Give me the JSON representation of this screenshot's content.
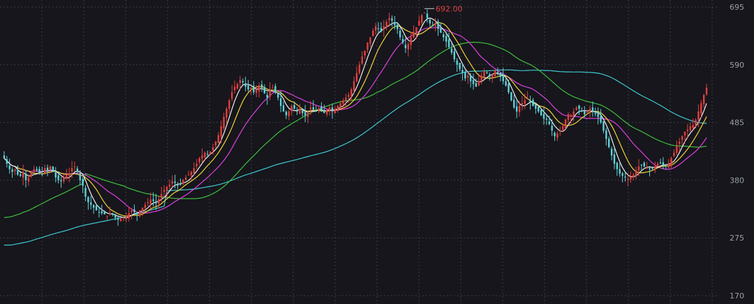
{
  "chart_data": {
    "type": "candlestick",
    "title": "",
    "xlabel": "",
    "ylabel": "",
    "ylim": [
      170,
      695
    ],
    "y_ticks": [
      {
        "value": 695,
        "label": "695"
      },
      {
        "value": 590,
        "label": "590"
      },
      {
        "value": 485,
        "label": "485"
      },
      {
        "value": 380,
        "label": "380"
      },
      {
        "value": 275,
        "label": "275"
      },
      {
        "value": 170,
        "label": "170"
      }
    ],
    "grid": true,
    "peak_annotation": {
      "value": 692.0,
      "label": "692.00"
    },
    "colors": {
      "background": "#16161c",
      "grid": "#3a3d44",
      "up": "#e0413e",
      "down": "#5fd3d9",
      "ma5": "#f0f0f0",
      "ma10": "#f2d43a",
      "ma20": "#e040e0",
      "ma60": "#3fbf3f",
      "ma120": "#3fc9d0",
      "peak": "#e0413e"
    },
    "closes": [
      420,
      410,
      400,
      395,
      400,
      390,
      388,
      395,
      380,
      385,
      392,
      400,
      398,
      395,
      390,
      402,
      398,
      405,
      395,
      385,
      380,
      378,
      385,
      390,
      392,
      402,
      405,
      395,
      380,
      370,
      350,
      340,
      335,
      330,
      325,
      322,
      320,
      318,
      315,
      320,
      318,
      312,
      308,
      310,
      312,
      315,
      320,
      325,
      322,
      318,
      325,
      330,
      335,
      340,
      345,
      342,
      338,
      345,
      355,
      362,
      368,
      372,
      378,
      375,
      370,
      372,
      380,
      385,
      390,
      395,
      402,
      410,
      420,
      425,
      430,
      428,
      432,
      440,
      450,
      462,
      478,
      495,
      510,
      525,
      540,
      550,
      555,
      562,
      558,
      550,
      545,
      548,
      540,
      545,
      552,
      548,
      538,
      530,
      545,
      548,
      540,
      530,
      515,
      505,
      498,
      505,
      515,
      510,
      505,
      510,
      502,
      498,
      505,
      512,
      508,
      505,
      510,
      506,
      502,
      508,
      512,
      505,
      510,
      515,
      520,
      525,
      530,
      535,
      545,
      560,
      575,
      590,
      605,
      615,
      630,
      640,
      652,
      660,
      655,
      650,
      660,
      668,
      675,
      670,
      662,
      655,
      640,
      630,
      620,
      628,
      640,
      650,
      658,
      670,
      680,
      685,
      675,
      665,
      660,
      665,
      655,
      648,
      640,
      632,
      622,
      612,
      600,
      590,
      582,
      575,
      565,
      570,
      560,
      555,
      550,
      560,
      570,
      578,
      575,
      568,
      572,
      580,
      575,
      568,
      560,
      552,
      540,
      525,
      512,
      505,
      515,
      520,
      525,
      528,
      522,
      515,
      510,
      505,
      498,
      492,
      490,
      482,
      470,
      460,
      465,
      470,
      478,
      490,
      500,
      498,
      505,
      512,
      510,
      505,
      500,
      505,
      510,
      505,
      500,
      495,
      485,
      470,
      455,
      440,
      425,
      410,
      400,
      392,
      388,
      385,
      382,
      385,
      390,
      398,
      405,
      408,
      405,
      402,
      400,
      402,
      405,
      410,
      412,
      408,
      405,
      410,
      420,
      430,
      442,
      450,
      460,
      468,
      472,
      478,
      480,
      490,
      505,
      520,
      535,
      548
    ]
  }
}
